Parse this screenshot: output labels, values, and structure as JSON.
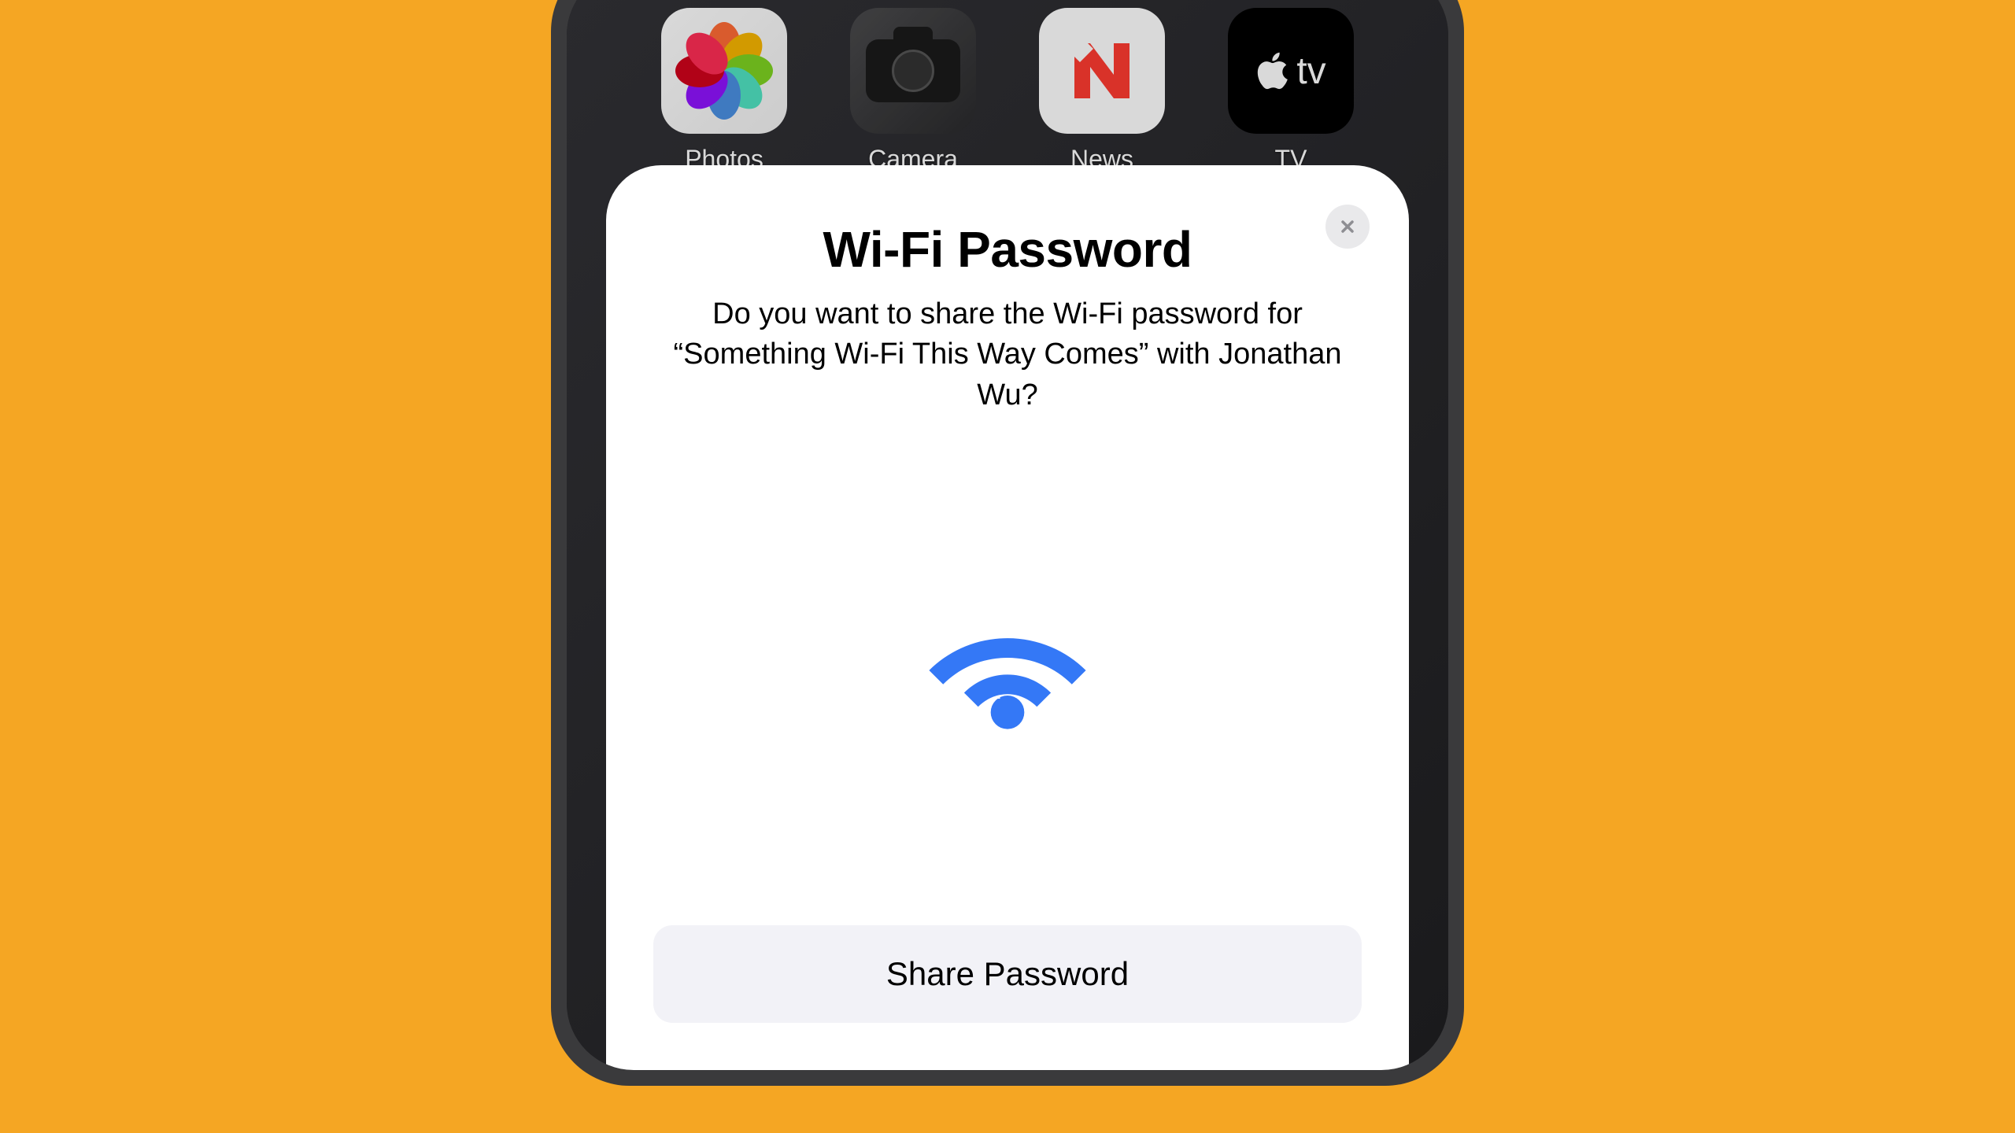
{
  "background": {
    "color": "#f5a623"
  },
  "home_screen": {
    "apps": [
      {
        "label": "Photos",
        "icon_name": "photos"
      },
      {
        "label": "Camera",
        "icon_name": "camera"
      },
      {
        "label": "News",
        "icon_name": "news"
      },
      {
        "label": "TV",
        "icon_name": "tv"
      }
    ]
  },
  "modal": {
    "title": "Wi-Fi Password",
    "body": "Do you want to share the Wi-Fi password for “Something Wi-Fi This Way Comes” with Jonathan Wu?",
    "network_name": "Something Wi-Fi This Way Comes",
    "recipient": "Jonathan Wu",
    "button_label": "Share Password",
    "wifi_icon_color": "#3478f6"
  }
}
